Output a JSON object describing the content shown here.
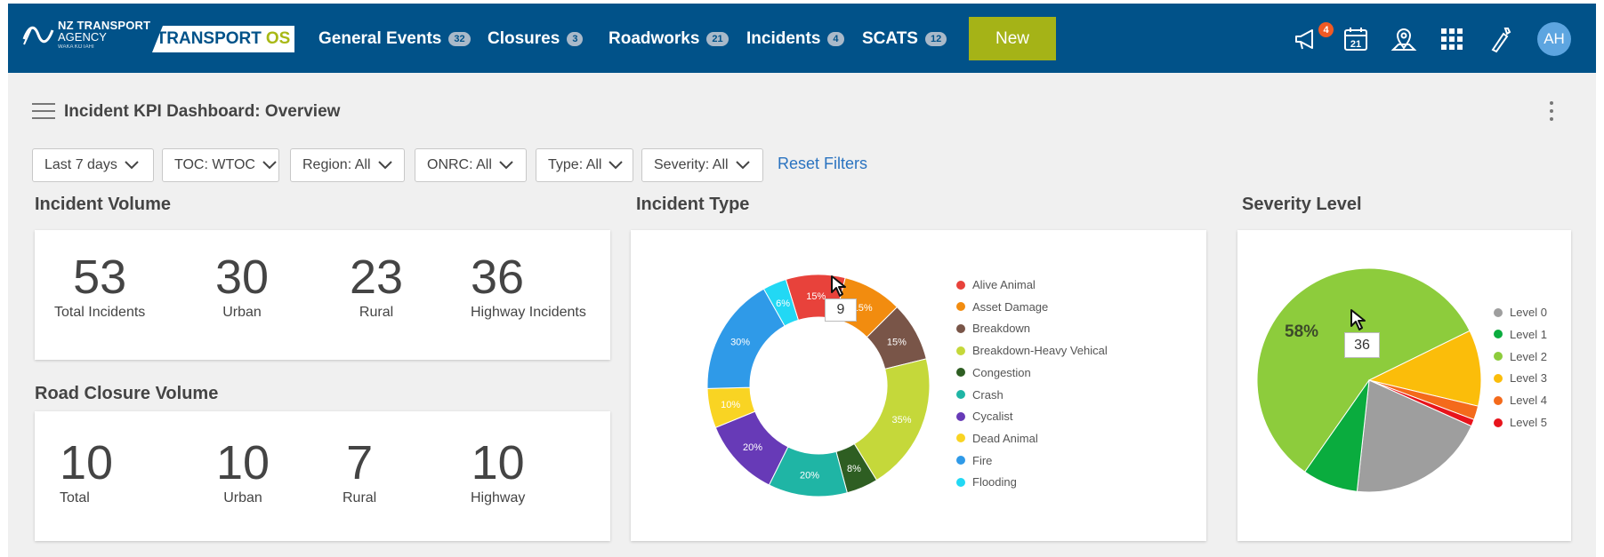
{
  "nav": {
    "logo_line1": "NZ TRANSPORT",
    "logo_line2": "AGENCY",
    "logo_line3": "WAKA KOTAHI",
    "product_name": "TRANSPORT",
    "product_suffix": "OS",
    "items": [
      {
        "label": "General Events",
        "count": "32"
      },
      {
        "label": "Closures",
        "count": "3"
      },
      {
        "label": "Roadworks",
        "count": "21"
      },
      {
        "label": "Incidents",
        "count": "4"
      },
      {
        "label": "SCATS",
        "count": "12"
      }
    ],
    "new_label": "New",
    "notification_count": "4",
    "calendar_day": "21",
    "avatar_initials": "AH",
    "tools": [
      "megaphone-icon",
      "calendar-icon",
      "map-pin-icon",
      "apps-grid-icon",
      "wand-icon"
    ]
  },
  "page": {
    "title": "Incident KPI Dashboard: Overview"
  },
  "filters": [
    {
      "label": "Last 7 days"
    },
    {
      "label": "TOC: WTOC"
    },
    {
      "label": "Region: All"
    },
    {
      "label": "ONRC: All"
    },
    {
      "label": "Type: All"
    },
    {
      "label": "Severity: All"
    }
  ],
  "reset_filters": "Reset Filters",
  "incident_volume": {
    "title": "Incident Volume",
    "stats": [
      {
        "value": "53",
        "label": "Total Incidents"
      },
      {
        "value": "30",
        "label": "Urban"
      },
      {
        "value": "23",
        "label": "Rural"
      },
      {
        "value": "36",
        "label": "Highway Incidents"
      }
    ]
  },
  "road_closure_volume": {
    "title": "Road Closure Volume",
    "stats": [
      {
        "value": "10",
        "label": "Total"
      },
      {
        "value": "10",
        "label": "Urban"
      },
      {
        "value": "7",
        "label": "Rural"
      },
      {
        "value": "10",
        "label": "Highway"
      }
    ]
  },
  "incident_type": {
    "title": "Incident Type",
    "tooltip": "9"
  },
  "severity_level": {
    "title": "Severity Level",
    "tooltip": "36",
    "big_label": "58%"
  },
  "chart_data": [
    {
      "type": "pie",
      "variant": "donut",
      "title": "Incident Type",
      "slices": [
        {
          "name": "Alive Animal",
          "value": 15,
          "label": "15%",
          "color": "#e8423b"
        },
        {
          "name": "Asset Damage",
          "value": 15,
          "label": "15%",
          "color": "#f28c0f"
        },
        {
          "name": "Breakdown",
          "value": 15,
          "label": "15%",
          "color": "#795548"
        },
        {
          "name": "Breakdown-Heavy Vehical",
          "value": 35,
          "label": "35%",
          "color": "#c5d83a"
        },
        {
          "name": "Congestion",
          "value": 8,
          "label": "8%",
          "color": "#2e5e22"
        },
        {
          "name": "Crash",
          "value": 20,
          "label": "20%",
          "color": "#1fb5a5"
        },
        {
          "name": "Cycalist",
          "value": 20,
          "label": "20%",
          "color": "#673ab7"
        },
        {
          "name": "Dead Animal",
          "value": 10,
          "label": "10%",
          "color": "#f9d423"
        },
        {
          "name": "Fire",
          "value": 30,
          "label": "30%",
          "color": "#2f9ae8"
        },
        {
          "name": "Flooding",
          "value": 6,
          "label": "6%",
          "color": "#22d8f4"
        }
      ],
      "legend_position": "right"
    },
    {
      "type": "pie",
      "title": "Severity Level",
      "slices": [
        {
          "name": "Level 0",
          "value": 20,
          "color": "#9e9e9e"
        },
        {
          "name": "Level 1",
          "value": 8,
          "color": "#0aac3e"
        },
        {
          "name": "Level 2",
          "value": 58,
          "color": "#8dcc3c"
        },
        {
          "name": "Level 3",
          "value": 11,
          "color": "#fbbd0a"
        },
        {
          "name": "Level 4",
          "value": 2,
          "color": "#f46a1b"
        },
        {
          "name": "Level 5",
          "value": 1,
          "color": "#e8141c"
        }
      ],
      "legend_position": "right"
    }
  ]
}
